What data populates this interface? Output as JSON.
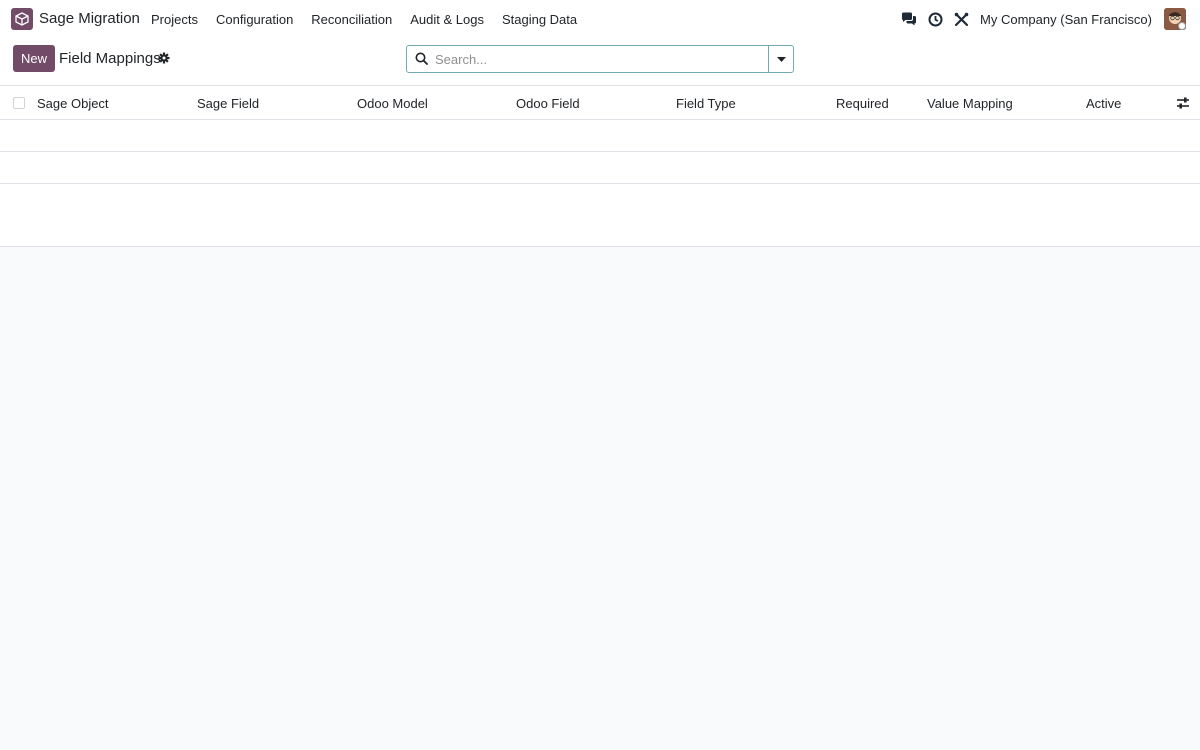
{
  "app": {
    "name": "Sage Migration",
    "menu": [
      "Projects",
      "Configuration",
      "Reconciliation",
      "Audit & Logs",
      "Staging Data"
    ],
    "company": "My Company (San Francisco)",
    "icons": [
      "messaging-icon",
      "activity-clock-icon",
      "debug-tools-icon"
    ],
    "brand_color": "#714b67"
  },
  "control_panel": {
    "new_label": "New",
    "title": "Field Mappings",
    "search_placeholder": "Search..."
  },
  "list": {
    "columns": [
      "Sage Object",
      "Sage Field",
      "Odoo Model",
      "Odoo Field",
      "Field Type",
      "Required",
      "Value Mapping",
      "Active"
    ],
    "rows": []
  }
}
